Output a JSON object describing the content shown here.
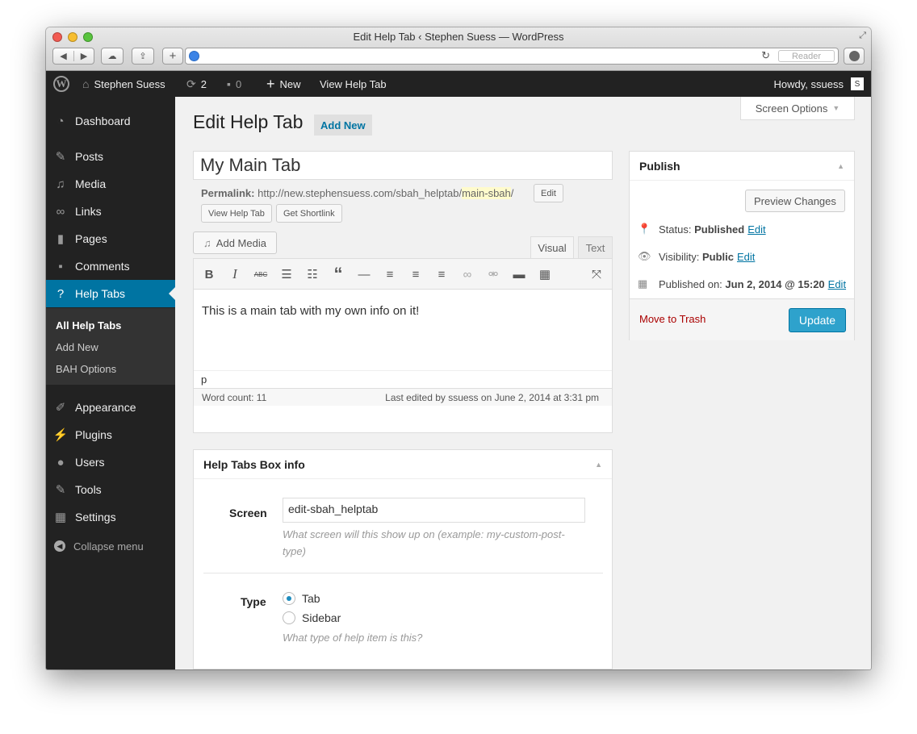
{
  "browser": {
    "window_title": "Edit Help Tab ‹ Stephen Suess — WordPress",
    "reader_label": "Reader",
    "icons": [
      "back-icon",
      "forward-icon",
      "icloud-tabs-icon",
      "share-icon",
      "new-tab-icon",
      "globe-icon",
      "reload-icon",
      "downloads-icon",
      "fullscreen-icon"
    ]
  },
  "adminbar": {
    "site_name": "Stephen Suess",
    "updates_count": "2",
    "comments_count": "0",
    "new_label": "New",
    "view_label": "View Help Tab",
    "howdy": "Howdy, ssuess",
    "avatar_letter": "S"
  },
  "sidebar": {
    "items": [
      {
        "label": "Dashboard",
        "icon": "dashboard-icon"
      },
      {
        "label": "Posts",
        "icon": "pin-icon"
      },
      {
        "label": "Media",
        "icon": "media-icon"
      },
      {
        "label": "Links",
        "icon": "links-icon"
      },
      {
        "label": "Pages",
        "icon": "pages-icon"
      },
      {
        "label": "Comments",
        "icon": "comments-icon"
      },
      {
        "label": "Help Tabs",
        "icon": "help-icon"
      },
      {
        "label": "Appearance",
        "icon": "brush-icon"
      },
      {
        "label": "Plugins",
        "icon": "plugin-icon"
      },
      {
        "label": "Users",
        "icon": "users-icon"
      },
      {
        "label": "Tools",
        "icon": "wrench-icon"
      },
      {
        "label": "Settings",
        "icon": "settings-icon"
      }
    ],
    "submenu": [
      "All Help Tabs",
      "Add New",
      "BAH Options"
    ],
    "collapse_label": "Collapse menu"
  },
  "header": {
    "screen_options": "Screen Options",
    "title": "Edit Help Tab",
    "add_new": "Add New"
  },
  "post": {
    "title": "My Main Tab",
    "permalink_label": "Permalink:",
    "permalink_base": "http://new.stephensuess.com/sbah_helptab/",
    "permalink_slug": "main-sbah",
    "permalink_end": "/",
    "edit_label": "Edit",
    "view_button": "View Help Tab",
    "shortlink_button": "Get Shortlink"
  },
  "editor": {
    "add_media": "Add Media",
    "tab_visual": "Visual",
    "tab_text": "Text",
    "content": "This is a main tab with my own info on it!",
    "path": "p",
    "word_count": "Word count: 11",
    "last_edited": "Last edited by ssuess on June 2, 2014 at 3:31 pm",
    "tools": [
      "bold-icon",
      "italic-icon",
      "strikethrough-icon",
      "bullet-list-icon",
      "numbered-list-icon",
      "blockquote-icon",
      "horizontal-rule-icon",
      "align-left-icon",
      "align-center-icon",
      "align-right-icon",
      "insert-link-icon",
      "unlink-icon",
      "insert-more-icon",
      "toolbar-toggle-icon",
      "fullscreen-icon"
    ]
  },
  "publish": {
    "title": "Publish",
    "preview": "Preview Changes",
    "status_label": "Status:",
    "status_value": "Published",
    "visibility_label": "Visibility:",
    "visibility_value": "Public",
    "published_label": "Published on:",
    "published_value": "Jun 2, 2014 @ 15:20",
    "edit": "Edit",
    "trash": "Move to Trash",
    "update": "Update"
  },
  "helpbox": {
    "title": "Help Tabs Box info",
    "screen_label": "Screen",
    "screen_value": "edit-sbah_helptab",
    "screen_desc_1": "What screen will this show up on (example: my-custom-post-",
    "screen_desc_2": "type)",
    "type_label": "Type",
    "type_options": [
      "Tab",
      "Sidebar"
    ],
    "selected_type": "Tab",
    "type_desc": "What type of help item is this?"
  }
}
